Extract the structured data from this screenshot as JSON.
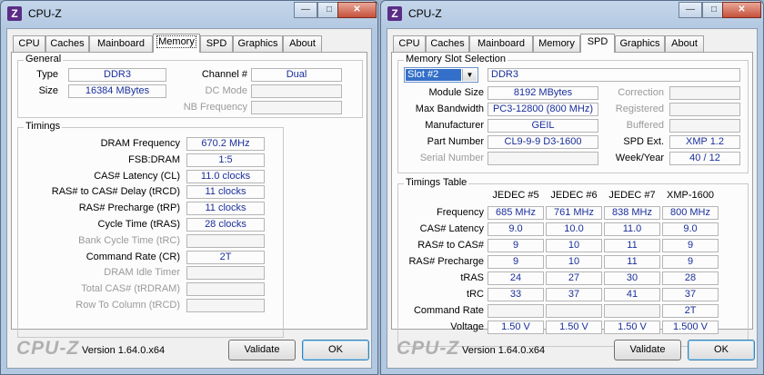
{
  "left": {
    "title": "CPU-Z",
    "tabs": [
      "CPU",
      "Caches",
      "Mainboard",
      "Memory",
      "SPD",
      "Graphics",
      "About"
    ],
    "active_tab": "Memory",
    "general": {
      "title": "General",
      "type_label": "Type",
      "type_value": "DDR3",
      "size_label": "Size",
      "size_value": "16384 MBytes",
      "channel_label": "Channel #",
      "channel_value": "Dual",
      "dcmode_label": "DC Mode",
      "dcmode_value": "",
      "nbfreq_label": "NB Frequency",
      "nbfreq_value": ""
    },
    "timings": {
      "title": "Timings",
      "rows": [
        {
          "label": "DRAM Frequency",
          "value": "670.2 MHz",
          "dim": false
        },
        {
          "label": "FSB:DRAM",
          "value": "1:5",
          "dim": false
        },
        {
          "label": "CAS# Latency (CL)",
          "value": "11.0 clocks",
          "dim": false
        },
        {
          "label": "RAS# to CAS# Delay (tRCD)",
          "value": "11 clocks",
          "dim": false
        },
        {
          "label": "RAS# Precharge (tRP)",
          "value": "11 clocks",
          "dim": false
        },
        {
          "label": "Cycle Time (tRAS)",
          "value": "28 clocks",
          "dim": false
        },
        {
          "label": "Bank Cycle Time (tRC)",
          "value": "",
          "dim": true
        },
        {
          "label": "Command Rate (CR)",
          "value": "2T",
          "dim": false
        },
        {
          "label": "DRAM Idle Timer",
          "value": "",
          "dim": true
        },
        {
          "label": "Total CAS# (tRDRAM)",
          "value": "",
          "dim": true
        },
        {
          "label": "Row To Column (tRCD)",
          "value": "",
          "dim": true
        }
      ]
    },
    "logo": "CPU-Z",
    "version": "Version 1.64.0.x64",
    "validate": "Validate",
    "ok": "OK"
  },
  "right": {
    "title": "CPU-Z",
    "tabs": [
      "CPU",
      "Caches",
      "Mainboard",
      "Memory",
      "SPD",
      "Graphics",
      "About"
    ],
    "active_tab": "SPD",
    "slot": {
      "title": "Memory Slot Selection",
      "selected": "Slot #2",
      "type": "DDR3",
      "left_rows": [
        {
          "label": "Module Size",
          "value": "8192 MBytes",
          "dim": false
        },
        {
          "label": "Max Bandwidth",
          "value": "PC3-12800 (800 MHz)",
          "dim": false
        },
        {
          "label": "Manufacturer",
          "value": "GEIL",
          "dim": false
        },
        {
          "label": "Part Number",
          "value": "CL9-9-9 D3-1600",
          "dim": false
        },
        {
          "label": "Serial Number",
          "value": "",
          "dim": true
        }
      ],
      "right_rows": [
        {
          "label": "Correction",
          "value": "",
          "dim": true
        },
        {
          "label": "Registered",
          "value": "",
          "dim": true
        },
        {
          "label": "Buffered",
          "value": "",
          "dim": true
        },
        {
          "label": "SPD Ext.",
          "value": "XMP 1.2",
          "dim": false
        },
        {
          "label": "Week/Year",
          "value": "40 / 12",
          "dim": false
        }
      ]
    },
    "table": {
      "title": "Timings Table",
      "columns": [
        "JEDEC #5",
        "JEDEC #6",
        "JEDEC #7",
        "XMP-1600"
      ],
      "rows": [
        {
          "label": "Frequency",
          "values": [
            "685 MHz",
            "761 MHz",
            "838 MHz",
            "800 MHz"
          ]
        },
        {
          "label": "CAS# Latency",
          "values": [
            "9.0",
            "10.0",
            "11.0",
            "9.0"
          ]
        },
        {
          "label": "RAS# to CAS#",
          "values": [
            "9",
            "10",
            "11",
            "9"
          ]
        },
        {
          "label": "RAS# Precharge",
          "values": [
            "9",
            "10",
            "11",
            "9"
          ]
        },
        {
          "label": "tRAS",
          "values": [
            "24",
            "27",
            "30",
            "28"
          ]
        },
        {
          "label": "tRC",
          "values": [
            "33",
            "37",
            "41",
            "37"
          ]
        },
        {
          "label": "Command Rate",
          "values": [
            "",
            "",
            "",
            "2T"
          ]
        },
        {
          "label": "Voltage",
          "values": [
            "1.50 V",
            "1.50 V",
            "1.50 V",
            "1.500 V"
          ]
        }
      ]
    },
    "logo": "CPU-Z",
    "version": "Version 1.64.0.x64",
    "validate": "Validate",
    "ok": "OK"
  }
}
